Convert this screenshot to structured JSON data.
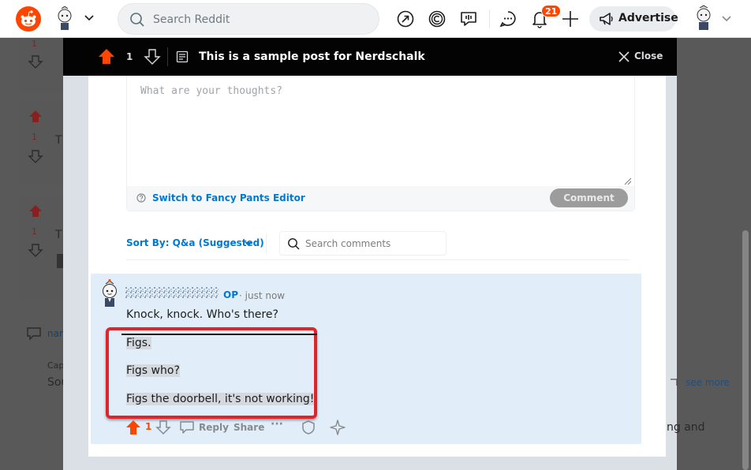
{
  "nav": {
    "search_placeholder": "Search Reddit",
    "notification_count": "21",
    "advertise_label": "Advertise"
  },
  "background": {
    "vote_counts": [
      "1",
      "1",
      "1"
    ],
    "fragments": [
      "T",
      "T",
      "nar",
      "Cap",
      "Sou"
    ],
    "see_more": "see more",
    "trailing_text": "ng and"
  },
  "modal": {
    "vote_count": "1",
    "post_title": "This is a sample post for Nerdschalk",
    "close_label": "Close"
  },
  "editor": {
    "placeholder": "What are your thoughts?",
    "switch_label": "Switch to Fancy Pants Editor",
    "comment_button": "Comment"
  },
  "sort": {
    "label": "Sort By: Q&a (Suggested)",
    "search_placeholder": "Search comments"
  },
  "comment": {
    "op_badge": "OP",
    "timestamp": "· just now",
    "lines": [
      "Knock, knock. Who's there?",
      "Figs.",
      "Figs who?",
      "Figs the doorbell, it's not working!"
    ],
    "vote_count": "1",
    "reply_label": "Reply",
    "share_label": "Share",
    "more_label": "···"
  },
  "colors": {
    "brand": "#ff4500",
    "link": "#0079d3",
    "highlight_box": "#e0242a",
    "comment_bg": "#e1eefa"
  }
}
